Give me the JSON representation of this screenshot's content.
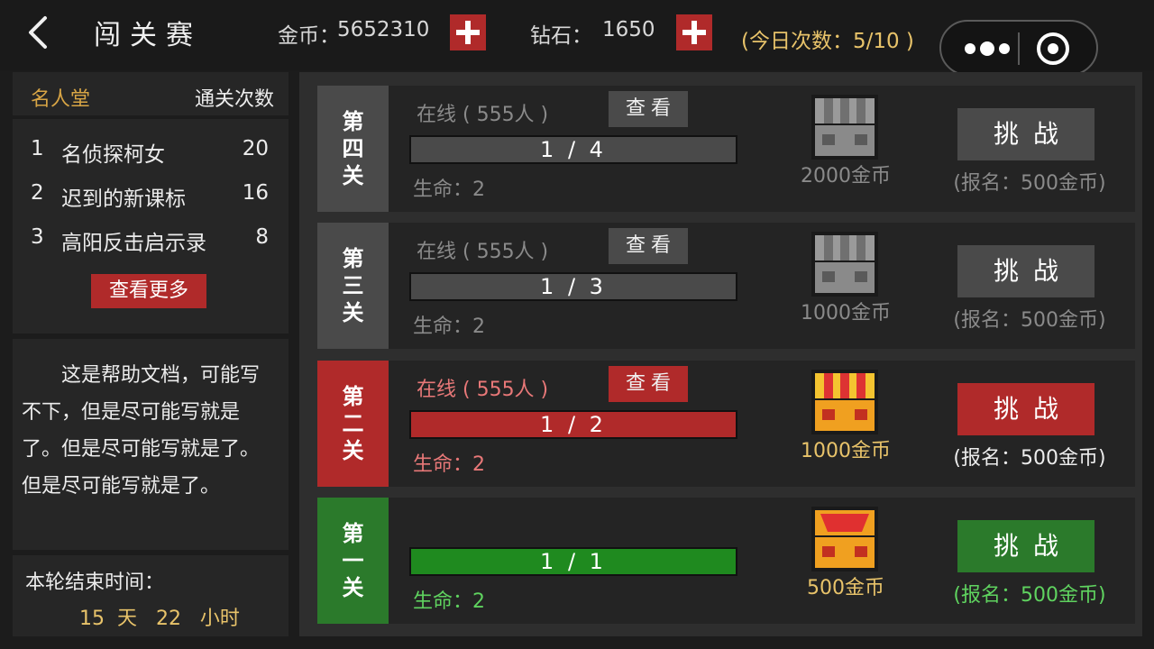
{
  "header": {
    "title": "闯关赛",
    "gold_label": "金币：",
    "gold_value": "5652310",
    "diamond_label": "钻石：",
    "diamond_value": "1650",
    "daily_attempts": "(今日次数：5/10 )"
  },
  "hall_of_fame": {
    "title": "名人堂",
    "column": "通关次数",
    "entries": [
      {
        "rank": "1",
        "name": "名侦探柯女",
        "count": "20"
      },
      {
        "rank": "2",
        "name": "迟到的新课标",
        "count": "16"
      },
      {
        "rank": "3",
        "name": "高阳反击启示录",
        "count": "8"
      }
    ],
    "more_label": "查看更多"
  },
  "help": {
    "text": "这是帮助文档，可能写不下，但是尽可能写就是了。但是尽可能写就是了。但是尽可能写就是了。"
  },
  "timer": {
    "label": "本轮结束时间：",
    "values": "15  天   22   小时"
  },
  "colors": {
    "red": "#b02a2a",
    "green": "#2b7a2b",
    "gray": "#4a4a4a",
    "gold": "#e8c36a",
    "life_green": "#5fd35f",
    "life_pink": "#e87878"
  },
  "levels": [
    {
      "badge": [
        "第",
        "四",
        "关"
      ],
      "online": "在线 ( 555人 )",
      "view_label": "查看",
      "progress_text": "1 / 4",
      "progress": 1.0,
      "life": "生命：2",
      "reward": "2000金币",
      "chest_icon": "chest-gray-icon",
      "challenge_label": "挑战",
      "signup": "(报名：500金币)",
      "state": "locked"
    },
    {
      "badge": [
        "第",
        "三",
        "关"
      ],
      "online": "在线 ( 555人 )",
      "view_label": "查看",
      "progress_text": "1 / 3",
      "progress": 1.0,
      "life": "生命：2",
      "reward": "1000金币",
      "chest_icon": "chest-gray-icon",
      "challenge_label": "挑战",
      "signup": "(报名：500金币)",
      "state": "locked"
    },
    {
      "badge": [
        "第",
        "二",
        "关"
      ],
      "online": "在线 ( 555人 )",
      "view_label": "查看",
      "progress_text": "1 / 2",
      "progress": 1.0,
      "life": "生命：2",
      "reward": "1000金币",
      "chest_icon": "chest-gold-icon",
      "challenge_label": "挑战",
      "signup": "(报名：500金币)",
      "state": "active"
    },
    {
      "badge": [
        "第",
        "一",
        "关"
      ],
      "online": "",
      "view_label": "",
      "progress_text": "1 / 1",
      "progress": 1.0,
      "life": "生命：2",
      "reward": "500金币",
      "chest_icon": "chest-red-icon",
      "challenge_label": "挑战",
      "signup": "(报名：500金币)",
      "state": "open"
    }
  ]
}
